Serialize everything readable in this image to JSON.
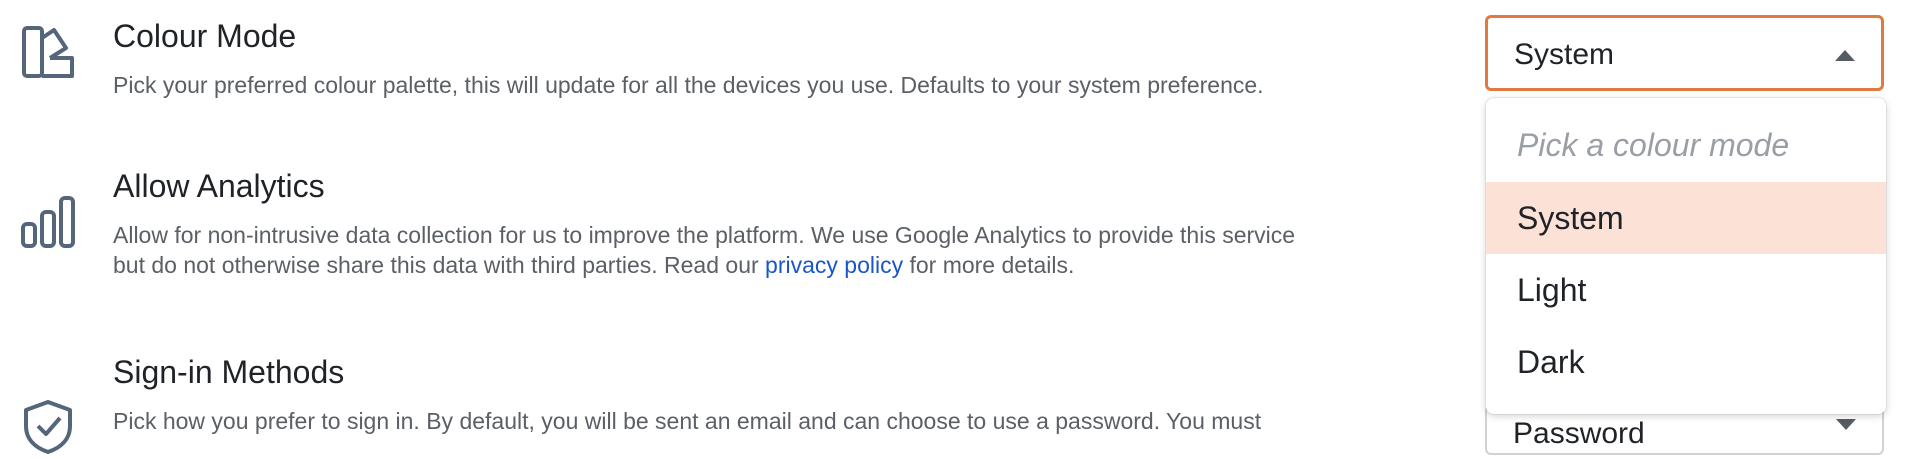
{
  "settings": {
    "colour_mode": {
      "title": "Colour Mode",
      "description": "Pick your preferred colour palette, this will update for all the devices you use. Defaults to your system preference.",
      "select_value": "System",
      "dropdown": {
        "placeholder": "Pick a colour mode",
        "options": [
          "System",
          "Light",
          "Dark"
        ],
        "selected": "System"
      }
    },
    "analytics": {
      "title": "Allow Analytics",
      "description_line1": "Allow for non-intrusive data collection for us to improve the platform. We use Google Analytics to provide this service",
      "description_line2_before": "but do not otherwise share this data with third parties. Read our ",
      "privacy_link": "privacy policy",
      "description_line2_after": " for more details."
    },
    "sign_in": {
      "title": "Sign-in Methods",
      "description": "Pick how you prefer to sign in. By default, you will be sent an email and can choose to use a password. You must",
      "select_value": "Password"
    }
  },
  "icons": {
    "colour_mode": "palette-swatch-icon",
    "analytics": "bar-chart-icon",
    "sign_in": "shield-check-icon"
  },
  "colors": {
    "accent_border": "#e07a3f",
    "selected_option_bg": "#fce1d6",
    "link": "#1a56c8"
  }
}
